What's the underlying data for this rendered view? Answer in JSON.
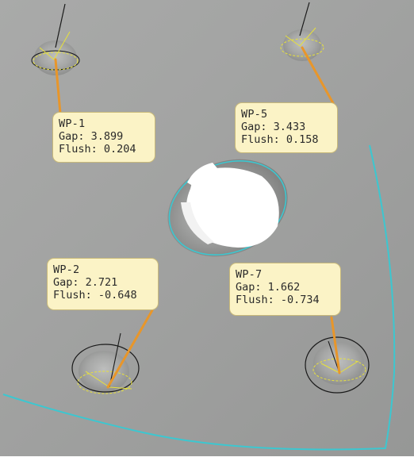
{
  "measurements": [
    {
      "id": "wp-1",
      "name": "WP-1",
      "gap": "Gap: 3.899",
      "flush": "Flush: 0.204"
    },
    {
      "id": "wp-5",
      "name": "WP-5",
      "gap": "Gap: 3.433",
      "flush": "Flush: 0.158"
    },
    {
      "id": "wp-2",
      "name": "WP-2",
      "gap": "Gap: 2.721",
      "flush": "Flush: -0.648"
    },
    {
      "id": "wp-7",
      "name": "WP-7",
      "gap": "Gap: 1.662",
      "flush": "Flush: -0.734"
    }
  ],
  "colors": {
    "leader_line": "#e8962a",
    "callout_fill": "#fbf3c6",
    "boundary_curve": "#3cc7d0",
    "measure_ellipse": "#e8e23a",
    "hole_rim": "#3cc7d0"
  },
  "icons": [
    "measurement-point-marker",
    "boundary-curve",
    "center-hole"
  ]
}
